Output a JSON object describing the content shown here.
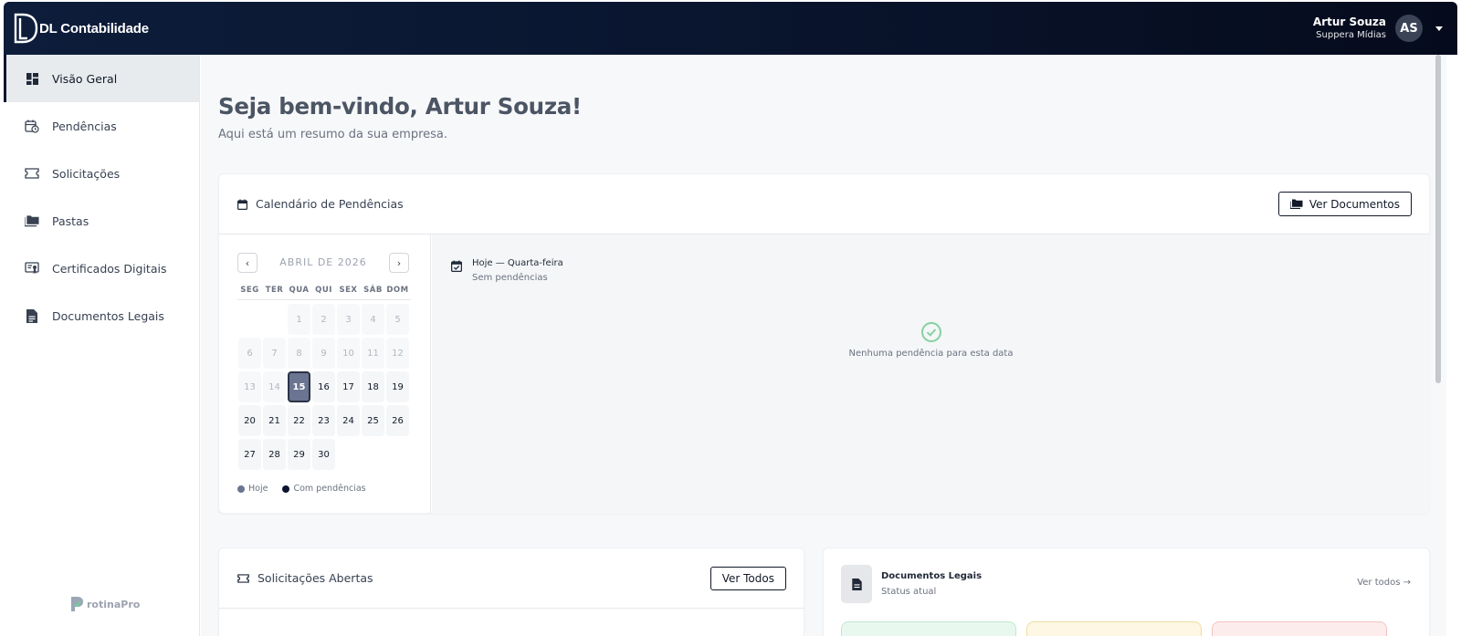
{
  "brand": {
    "name": "DL Contabilidade"
  },
  "user": {
    "name": "Artur Souza",
    "company": "Suppera Mídias",
    "initials": "AS"
  },
  "sidebar": {
    "items": [
      {
        "label": "Visão Geral",
        "icon": "dashboard-icon",
        "active": true
      },
      {
        "label": "Pendências",
        "icon": "calendar-clock-icon",
        "active": false
      },
      {
        "label": "Solicitações",
        "icon": "ticket-icon",
        "active": false
      },
      {
        "label": "Pastas",
        "icon": "folders-icon",
        "active": false
      },
      {
        "label": "Certificados Digitais",
        "icon": "certificate-icon",
        "active": false
      },
      {
        "label": "Documentos Legais",
        "icon": "document-icon",
        "active": false
      }
    ],
    "footer_brand": "rotinaPro"
  },
  "main": {
    "welcome": "Seja bem-vindo, Artur Souza!",
    "subtitle": "Aqui está um resumo da sua empresa."
  },
  "calendar_card": {
    "title": "Calendário de Pendências",
    "button": "Ver Documentos",
    "month": "ABRIL DE 2026",
    "weekdays": [
      "SEG",
      "TER",
      "QUA",
      "QUI",
      "SEX",
      "SÁB",
      "DOM"
    ],
    "weeks": [
      [
        "",
        "",
        "1",
        "2",
        "3",
        "4",
        "5"
      ],
      [
        "6",
        "7",
        "8",
        "9",
        "10",
        "11",
        "12"
      ],
      [
        "13",
        "14",
        "15",
        "16",
        "17",
        "18",
        "19"
      ],
      [
        "20",
        "21",
        "22",
        "23",
        "24",
        "25",
        "26"
      ],
      [
        "27",
        "28",
        "29",
        "30",
        "",
        "",
        ""
      ]
    ],
    "today": "15",
    "legend": {
      "today": "Hoje",
      "pending": "Com pendências"
    },
    "selected_title": "Hoje — Quarta-feira",
    "selected_sub": "Sem pendências",
    "empty_message": "Nenhuma pendência para esta data",
    "colors": {
      "today": "#6b7490",
      "pending": "#0b1530",
      "success": "#86d0a0"
    }
  },
  "solicitacoes_card": {
    "title": "Solicitações Abertas",
    "button": "Ver Todos"
  },
  "documentos_card": {
    "title": "Documentos Legais",
    "subtitle": "Status atual",
    "link": "Ver todos →",
    "status_colors": [
      "#e9f8ef",
      "#fdf7e3",
      "#fdecec"
    ]
  }
}
